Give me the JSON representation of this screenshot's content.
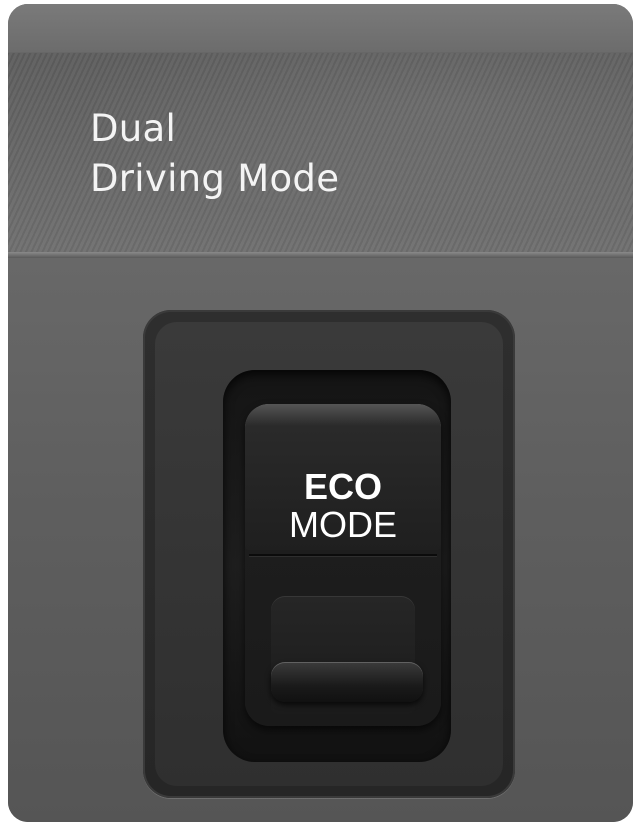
{
  "headline": {
    "line1": "Dual",
    "line2": "Driving Mode"
  },
  "switch": {
    "line1": "ECO",
    "line2": "MODE"
  },
  "colors": {
    "text": "#f4f4f4",
    "panel": "#5e5e5e",
    "switch_body": "#1d1d1d"
  }
}
